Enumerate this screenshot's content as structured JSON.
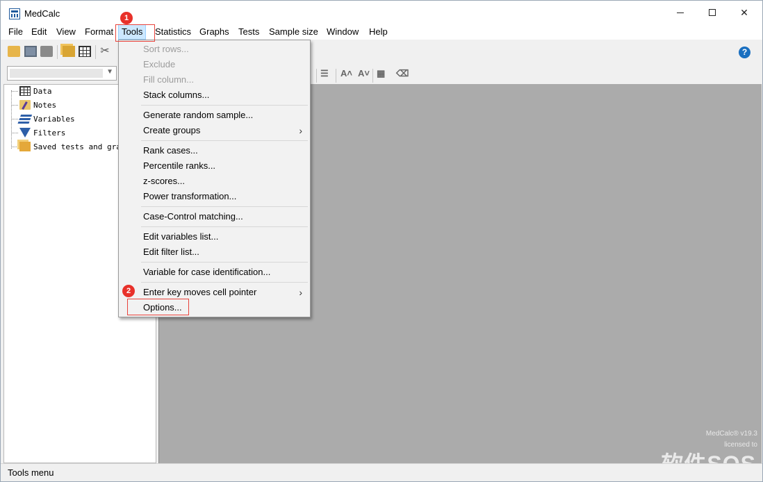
{
  "window": {
    "title": "MedCalc"
  },
  "menubar": {
    "items": [
      "File",
      "Edit",
      "View",
      "Format",
      "Tools",
      "Statistics",
      "Graphs",
      "Tests",
      "Sample size",
      "Window",
      "Help"
    ],
    "active": "Tools"
  },
  "toolbar": {
    "icons": [
      "open-folder-icon",
      "save-icon",
      "print-icon",
      "copy-icon",
      "spreadsheet-icon",
      "scissors-icon",
      "help-icon"
    ],
    "help_glyph": "?"
  },
  "toolbar2": {
    "combo_value": ""
  },
  "tree": {
    "items": [
      "Data",
      "Notes",
      "Variables",
      "Filters",
      "Saved tests and graphs"
    ]
  },
  "tools_menu": {
    "items": [
      {
        "label": "Sort rows...",
        "disabled": true
      },
      {
        "label": "Exclude",
        "disabled": true
      },
      {
        "label": "Fill column...",
        "disabled": true
      },
      {
        "label": "Stack columns..."
      },
      {
        "label": "Generate random sample..."
      },
      {
        "label": "Create groups",
        "submenu": true
      },
      {
        "label": "Rank cases..."
      },
      {
        "label": "Percentile ranks..."
      },
      {
        "label": "z-scores..."
      },
      {
        "label": "Power transformation..."
      },
      {
        "label": "Case-Control matching..."
      },
      {
        "label": "Edit variables list..."
      },
      {
        "label": "Edit filter list..."
      },
      {
        "label": "Variable for case identification..."
      },
      {
        "label": "Enter key moves cell pointer",
        "submenu": true
      },
      {
        "label": "Options..."
      }
    ]
  },
  "workspace": {
    "watermark_version": "MedCalc® v19.3",
    "watermark_license": "licensed to",
    "watermark_site": "软件SOS"
  },
  "status": {
    "text": "Tools menu"
  },
  "annotations": {
    "badge1": "1",
    "badge2": "2"
  },
  "colors": {
    "accent": "#1a6fc0",
    "annotation_red": "#e8312a",
    "workspace_gray": "#ababab",
    "menu_highlight": "#cce8ff"
  }
}
